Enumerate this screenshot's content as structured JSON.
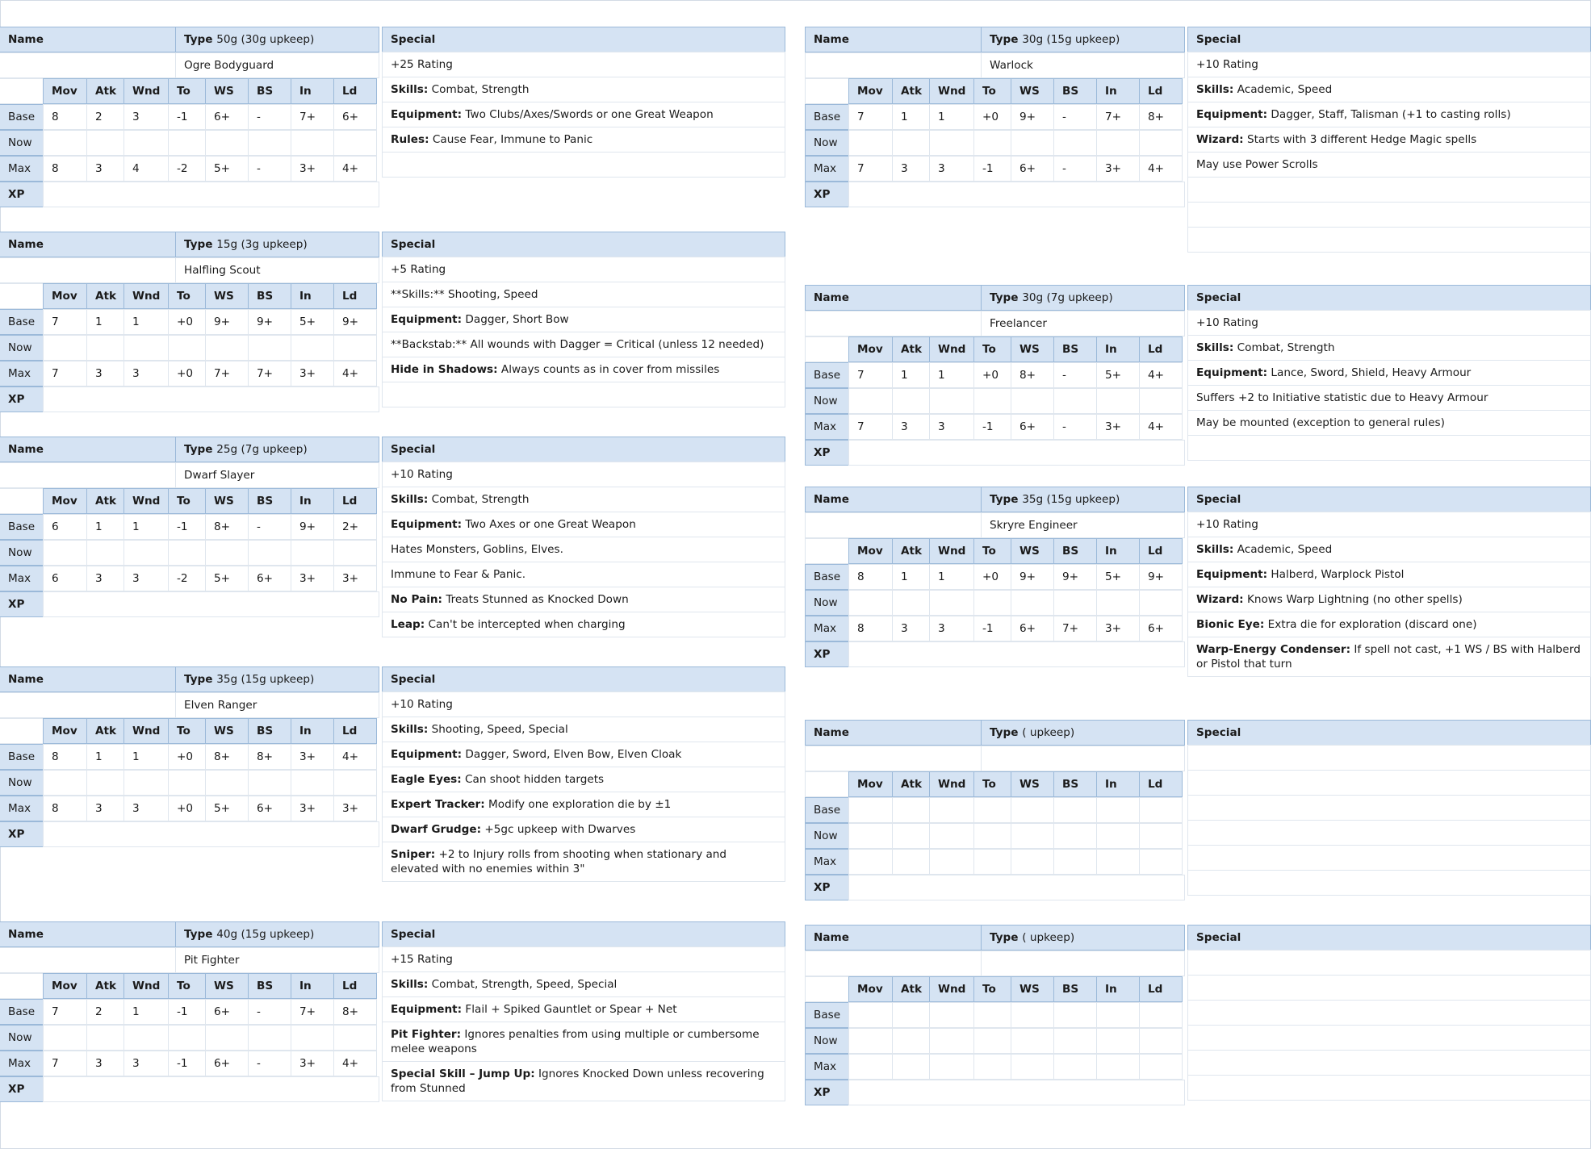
{
  "headers": {
    "name": "Name",
    "type": "Type",
    "special": "Special",
    "stats": [
      "Mov",
      "Atk",
      "Wnd",
      "To",
      "WS",
      "BS",
      "In",
      "Ld"
    ],
    "rows": [
      "Base",
      "Now",
      "Max"
    ],
    "xp": "XP"
  },
  "cards": [
    {
      "cost": "50g (30g upkeep)",
      "type_name": "Ogre Bodyguard",
      "base": [
        "8",
        "2",
        "3",
        "-1",
        "6+",
        "-",
        "7+",
        "6+"
      ],
      "max": [
        "8",
        "3",
        "4",
        "-2",
        "5+",
        "-",
        "3+",
        "4+"
      ],
      "special": [
        {
          "label": "",
          "text": "+25 Rating"
        },
        {
          "label": "Skills:",
          "text": " Combat, Strength"
        },
        {
          "label": "Equipment:",
          "text": " Two Clubs/Axes/Swords or one Great Weapon"
        },
        {
          "label": "Rules:",
          "text": " Cause Fear, Immune to Panic"
        },
        {
          "label": "",
          "text": ""
        }
      ]
    },
    {
      "cost": "15g (3g upkeep)",
      "type_name": "Halfling Scout",
      "base": [
        "7",
        "1",
        "1",
        "+0",
        "9+",
        "9+",
        "5+",
        "9+"
      ],
      "max": [
        "7",
        "3",
        "3",
        "+0",
        "7+",
        "7+",
        "3+",
        "4+"
      ],
      "special": [
        {
          "label": "",
          "text": "+5 Rating"
        },
        {
          "label": "",
          "text": "**Skills:** Shooting, Speed"
        },
        {
          "label": "Equipment:",
          "text": " Dagger, Short Bow"
        },
        {
          "label": "",
          "text": "**Backstab:** All wounds with Dagger = Critical (unless 12 needed)"
        },
        {
          "label": "Hide in Shadows:",
          "text": " Always counts as in cover from missiles"
        },
        {
          "label": "",
          "text": ""
        }
      ]
    },
    {
      "cost": "25g (7g upkeep)",
      "type_name": "Dwarf Slayer",
      "base": [
        "6",
        "1",
        "1",
        "-1",
        "8+",
        "-",
        "9+",
        "2+"
      ],
      "max": [
        "6",
        "3",
        "3",
        "-2",
        "5+",
        "6+",
        "3+",
        "3+"
      ],
      "special": [
        {
          "label": "",
          "text": "+10 Rating"
        },
        {
          "label": "Skills:",
          "text": " Combat, Strength"
        },
        {
          "label": "Equipment:",
          "text": " Two Axes or one Great Weapon"
        },
        {
          "label": "",
          "text": "Hates Monsters, Goblins, Elves."
        },
        {
          "label": "",
          "text": "Immune to Fear & Panic."
        },
        {
          "label": "No Pain:",
          "text": " Treats Stunned as Knocked Down"
        },
        {
          "label": "Leap:",
          "text": " Can't be intercepted when charging"
        }
      ]
    },
    {
      "cost": "35g (15g upkeep)",
      "type_name": "Elven Ranger",
      "base": [
        "8",
        "1",
        "1",
        "+0",
        "8+",
        "8+",
        "3+",
        "4+"
      ],
      "max": [
        "8",
        "3",
        "3",
        "+0",
        "5+",
        "6+",
        "3+",
        "3+"
      ],
      "special": [
        {
          "label": "",
          "text": "+10 Rating"
        },
        {
          "label": "Skills:",
          "text": " Shooting, Speed, Special"
        },
        {
          "label": "Equipment:",
          "text": " Dagger, Sword, Elven Bow, Elven Cloak"
        },
        {
          "label": "Eagle Eyes:",
          "text": " Can shoot hidden targets"
        },
        {
          "label": "Expert Tracker:",
          "text": " Modify one exploration die by ±1"
        },
        {
          "label": "Dwarf Grudge:",
          "text": " +5gc upkeep with Dwarves"
        },
        {
          "label": "Sniper:",
          "text": " +2 to Injury rolls from shooting when stationary and elevated with no enemies within 3\"",
          "tall": true
        }
      ]
    },
    {
      "cost": "40g (15g upkeep)",
      "type_name": "Pit Fighter",
      "base": [
        "7",
        "2",
        "1",
        "-1",
        "6+",
        "-",
        "7+",
        "8+"
      ],
      "max": [
        "7",
        "3",
        "3",
        "-1",
        "6+",
        "-",
        "3+",
        "4+"
      ],
      "special": [
        {
          "label": "",
          "text": "+15 Rating"
        },
        {
          "label": "Skills:",
          "text": " Combat, Strength, Speed, Special"
        },
        {
          "label": "Equipment:",
          "text": " Flail + Spiked Gauntlet or Spear + Net"
        },
        {
          "label": "Pit Fighter:",
          "text": " Ignores penalties from using multiple or cumbersome melee weapons",
          "tall": true
        },
        {
          "label": "Special Skill – Jump Up:",
          "text": " Ignores Knocked Down unless recovering from Stunned",
          "tall": true
        }
      ]
    },
    {
      "cost": "30g (15g upkeep)",
      "type_name": "Warlock",
      "base": [
        "7",
        "1",
        "1",
        "+0",
        "9+",
        "-",
        "7+",
        "8+"
      ],
      "max": [
        "7",
        "3",
        "3",
        "-1",
        "6+",
        "-",
        "3+",
        "4+"
      ],
      "special": [
        {
          "label": "",
          "text": "+10 Rating"
        },
        {
          "label": "Skills:",
          "text": " Academic, Speed"
        },
        {
          "label": "Equipment:",
          "text": " Dagger, Staff, Talisman (+1 to casting rolls)"
        },
        {
          "label": "Wizard:",
          "text": " Starts with 3 different Hedge Magic spells"
        },
        {
          "label": "",
          "text": "May use Power Scrolls"
        },
        {
          "label": "",
          "text": ""
        },
        {
          "label": "",
          "text": ""
        },
        {
          "label": "",
          "text": ""
        }
      ]
    },
    {
      "cost": "30g (7g upkeep)",
      "type_name": "Freelancer",
      "base": [
        "7",
        "1",
        "1",
        "+0",
        "8+",
        "-",
        "5+",
        "4+"
      ],
      "max": [
        "7",
        "3",
        "3",
        "-1",
        "6+",
        "-",
        "3+",
        "4+"
      ],
      "special": [
        {
          "label": "",
          "text": "+10 Rating"
        },
        {
          "label": "Skills:",
          "text": " Combat, Strength"
        },
        {
          "label": "Equipment:",
          "text": " Lance, Sword, Shield, Heavy Armour"
        },
        {
          "label": "",
          "text": "Suffers +2 to Initiative statistic due to Heavy Armour"
        },
        {
          "label": "",
          "text": "May be mounted (exception to general rules)"
        },
        {
          "label": "",
          "text": ""
        }
      ]
    },
    {
      "cost": "35g (15g upkeep)",
      "type_name": "Skryre Engineer",
      "base": [
        "8",
        "1",
        "1",
        "+0",
        "9+",
        "9+",
        "5+",
        "9+"
      ],
      "max": [
        "8",
        "3",
        "3",
        "-1",
        "6+",
        "7+",
        "3+",
        "6+"
      ],
      "special": [
        {
          "label": "",
          "text": "+10 Rating"
        },
        {
          "label": "Skills:",
          "text": " Academic, Speed"
        },
        {
          "label": "Equipment:",
          "text": " Halberd, Warplock Pistol"
        },
        {
          "label": "Wizard:",
          "text": " Knows Warp Lightning (no other spells)"
        },
        {
          "label": "Bionic Eye:",
          "text": " Extra die for exploration (discard one)"
        },
        {
          "label": "Warp-Energy Condenser:",
          "text": " If spell not cast, +1 WS / BS with Halberd or Pistol that turn",
          "tall": true
        }
      ]
    },
    {
      "cost": " ( upkeep)",
      "type_name": "",
      "base": [
        "",
        "",
        "",
        "",
        "",
        "",
        "",
        ""
      ],
      "max": [
        "",
        "",
        "",
        "",
        "",
        "",
        "",
        ""
      ],
      "special": [
        {
          "label": "",
          "text": ""
        },
        {
          "label": "",
          "text": ""
        },
        {
          "label": "",
          "text": ""
        },
        {
          "label": "",
          "text": ""
        },
        {
          "label": "",
          "text": ""
        },
        {
          "label": "",
          "text": ""
        }
      ]
    },
    {
      "cost": " ( upkeep)",
      "type_name": "",
      "base": [
        "",
        "",
        "",
        "",
        "",
        "",
        "",
        ""
      ],
      "max": [
        "",
        "",
        "",
        "",
        "",
        "",
        "",
        ""
      ],
      "special": [
        {
          "label": "",
          "text": ""
        },
        {
          "label": "",
          "text": ""
        },
        {
          "label": "",
          "text": ""
        },
        {
          "label": "",
          "text": ""
        },
        {
          "label": "",
          "text": ""
        },
        {
          "label": "",
          "text": ""
        }
      ]
    }
  ]
}
